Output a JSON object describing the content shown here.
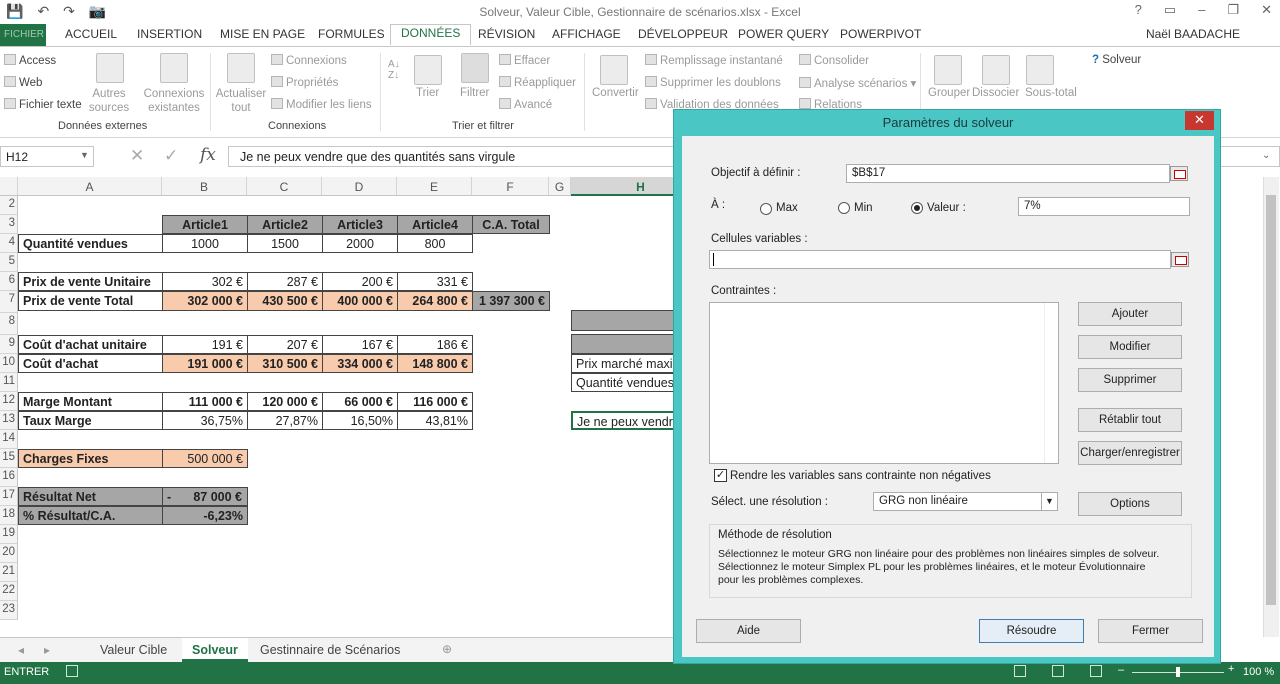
{
  "app": {
    "title": "Solveur, Valeur Cible, Gestionnaire de scénarios.xlsx - Excel",
    "user": "Naël BAADACHE",
    "window_controls": [
      "?",
      "▭",
      "–",
      "❐",
      "✕"
    ]
  },
  "qat": {
    "save": "💾",
    "undo": "↶",
    "redo": "↷",
    "camera": "📷"
  },
  "tabs": [
    "FICHIER",
    "ACCUEIL",
    "INSERTION",
    "MISE EN PAGE",
    "FORMULES",
    "DONNÉES",
    "RÉVISION",
    "AFFICHAGE",
    "DÉVELOPPEUR",
    "POWER QUERY",
    "POWERPIVOT"
  ],
  "ribbon": {
    "access": "Access",
    "web": "Web",
    "text_file": "Fichier texte",
    "other_sources": "Autres sources",
    "existing_connections": "Connexions existantes",
    "group_external": "Données externes",
    "refresh_all": "Actualiser tout",
    "connections": "Connexions",
    "properties": "Propriétés",
    "edit_links": "Modifier les liens",
    "group_connections": "Connexions",
    "sort": "Trier",
    "filter": "Filtrer",
    "clear": "Effacer",
    "reapply": "Réappliquer",
    "advanced": "Avancé",
    "group_sort": "Trier et filtrer",
    "convert": "Convertir",
    "flash_fill": "Remplissage instantané",
    "remove_duplicates": "Supprimer les doublons",
    "data_validation": "Validation des données",
    "consolidate": "Consolider",
    "what_if": "Analyse scénarios",
    "relations": "Relations",
    "group": "Grouper",
    "ungroup": "Dissocier",
    "subtotal": "Sous-total",
    "solver": "Solveur"
  },
  "formula_bar": {
    "name_box": "H12",
    "content": "Je ne peux vendre que des quantités sans virgule",
    "fx": "fx"
  },
  "columns": [
    "A",
    "B",
    "C",
    "D",
    "E",
    "F",
    "G",
    "H"
  ],
  "rows": [
    "2",
    "3",
    "4",
    "5",
    "6",
    "7",
    "8",
    "9",
    "10",
    "11",
    "12",
    "13",
    "14",
    "15",
    "16",
    "17",
    "18",
    "19",
    "20",
    "21",
    "22",
    "23"
  ],
  "sheet": {
    "headers": [
      "Article1",
      "Article2",
      "Article3",
      "Article4",
      "C.A. Total"
    ],
    "qty_label": "Quantité vendues",
    "qty": [
      "1000",
      "1500",
      "2000",
      "800"
    ],
    "pu_label": "Prix de vente Unitaire",
    "pu": [
      "302 €",
      "287 €",
      "200 €",
      "331 €"
    ],
    "pt_label": "Prix de vente Total",
    "pt": [
      "302 000 €",
      "430 500 €",
      "400 000 €",
      "264 800 €",
      "1 397 300 €"
    ],
    "cu_label": "Coût d'achat unitaire",
    "cu": [
      "191 €",
      "207 €",
      "167 €",
      "186 €"
    ],
    "ca_label": "Coût d'achat",
    "ca": [
      "191 000 €",
      "310 500 €",
      "334 000 €",
      "148 800 €"
    ],
    "mm_label": "Marge Montant",
    "mm": [
      "111 000 €",
      "120 000 €",
      "66 000 €",
      "116 000 €"
    ],
    "tm_label": "Taux Marge",
    "tm": [
      "36,75%",
      "27,87%",
      "16,50%",
      "43,81%"
    ],
    "cf_label": "Charges Fixes",
    "cf": "500 000 €",
    "rn_label": "Résultat Net",
    "rn_sign": "-",
    "rn": "87 000 €",
    "pr_label": "% Résultat/C.A.",
    "pr": "-6,23%",
    "h9": "Prix marché maxi",
    "h10": "Quantité vendues",
    "h12": "Je ne peux vendre"
  },
  "sheet_tabs": [
    "Valeur Cible",
    "Solveur",
    "Gestinnaire de Scénarios"
  ],
  "status": {
    "mode": "ENTRER",
    "zoom": "100 %"
  },
  "dialog": {
    "title": "Paramètres du solveur",
    "objective_label": "Objectif à définir :",
    "objective": "$B$17",
    "to_label": "À :",
    "max": "Max",
    "min": "Min",
    "value_label": "Valeur :",
    "value": "7%",
    "variables_label": "Cellules variables :",
    "variables": "",
    "constraints_label": "Contraintes :",
    "add": "Ajouter",
    "modify": "Modifier",
    "delete": "Supprimer",
    "reset": "Rétablir tout",
    "load_save": "Charger/enregistrer",
    "nonneg": "Rendre les variables sans contrainte non négatives",
    "nonneg_checked": true,
    "method_select_label": "Sélect. une résolution :",
    "method": "GRG non linéaire",
    "options": "Options",
    "method_title": "Méthode de résolution",
    "method_desc1": "Sélectionnez le moteur GRG non linéaire pour des problèmes non linéaires simples de solveur.",
    "method_desc2": "Sélectionnez le moteur Simplex PL pour les problèmes linéaires, et le moteur Évolutionnaire",
    "method_desc3": "pour les problèmes complexes.",
    "help": "Aide",
    "solve": "Résoudre",
    "close": "Fermer"
  }
}
